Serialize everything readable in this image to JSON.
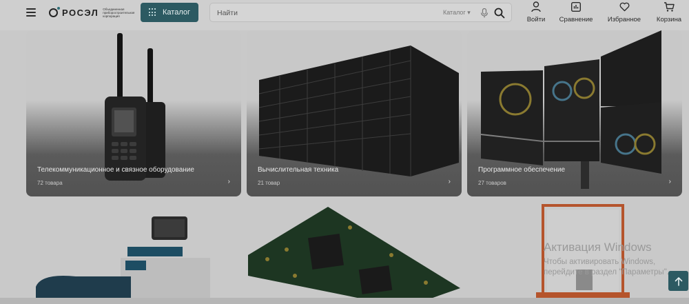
{
  "header": {
    "logo": {
      "text": "РОСЭЛ",
      "subtitle": "Объединенная приборостроительная корпорация"
    },
    "catalog_button": "Каталог",
    "search": {
      "placeholder": "Найти",
      "scope": "Каталог"
    },
    "actions": [
      {
        "label": "Войти",
        "icon": "user-icon"
      },
      {
        "label": "Сравнение",
        "icon": "compare-icon"
      },
      {
        "label": "Избранное",
        "icon": "heart-icon"
      },
      {
        "label": "Корзина",
        "icon": "cart-icon"
      }
    ]
  },
  "categories": [
    {
      "title": "Телекоммуникационное и связное оборудование",
      "count": "72 товара"
    },
    {
      "title": "Вычислительная техника",
      "count": "21 товар"
    },
    {
      "title": "Программное обеспечение",
      "count": "27 товаров"
    },
    {
      "title": "",
      "count": ""
    },
    {
      "title": "",
      "count": ""
    },
    {
      "title": "",
      "count": ""
    }
  ],
  "watermark": {
    "line1": "Активация Windows",
    "line2": "Чтобы активировать Windows,",
    "line3": "перейдите в раздел \"Параметры\"."
  },
  "colors": {
    "brand": "#2c5a62",
    "header_bg": "#cfcfcf",
    "page_bg": "#c9c9c9"
  }
}
